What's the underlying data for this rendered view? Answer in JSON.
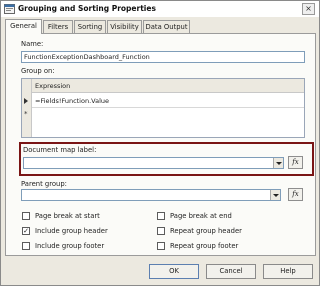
{
  "window": {
    "title": "Grouping and Sorting Properties",
    "close_glyph": "×"
  },
  "tabs": [
    "General",
    "Filters",
    "Sorting",
    "Visibility",
    "Data Output"
  ],
  "general": {
    "name_label": "Name:",
    "name_value": "FunctionExceptionDashboard_Function",
    "group_on_label": "Group on:",
    "group_on_header": "Expression",
    "expressions": [
      "=Fields!Function.Value"
    ],
    "new_row_marker": "*"
  },
  "document_map": {
    "label": "Document map label:",
    "value": "",
    "fx_label": "fx"
  },
  "parent_group": {
    "label": "Parent group:",
    "value": "",
    "fx_label": "fx"
  },
  "checkboxes": [
    {
      "label": "Page break at start",
      "checked": false
    },
    {
      "label": "Page break at end",
      "checked": false
    },
    {
      "label": "Include group header",
      "checked": true
    },
    {
      "label": "Repeat group header",
      "checked": false
    },
    {
      "label": "Include group footer",
      "checked": false
    },
    {
      "label": "Repeat group footer",
      "checked": false
    }
  ],
  "check_glyph": "✓",
  "buttons": {
    "ok": "OK",
    "cancel": "Cancel",
    "help": "Help"
  },
  "colors": {
    "highlight_border": "#7a1515",
    "dialog_bg": "#ece9e0",
    "input_border": "#7f9db9"
  }
}
